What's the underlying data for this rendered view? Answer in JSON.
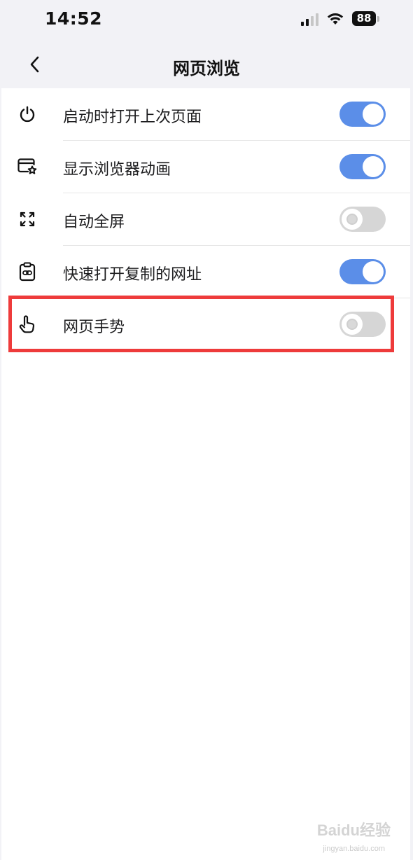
{
  "status_bar": {
    "time": "14:52",
    "battery": "88",
    "icons": [
      "cellular-signal-icon",
      "wifi-icon",
      "battery-icon"
    ]
  },
  "nav": {
    "title": "网页浏览",
    "back_icon": "chevron-left-icon"
  },
  "settings": [
    {
      "label": "启动时打开上次页面",
      "icon": "power-icon",
      "enabled": true
    },
    {
      "label": "显示浏览器动画",
      "icon": "browser-star-icon",
      "enabled": true
    },
    {
      "label": "自动全屏",
      "icon": "fullscreen-icon",
      "enabled": false
    },
    {
      "label": "快速打开复制的网址",
      "icon": "clipboard-link-icon",
      "enabled": true
    },
    {
      "label": "网页手势",
      "icon": "hand-gesture-icon",
      "enabled": false
    }
  ],
  "highlight": {
    "color": "#ee3b3b",
    "target": "网页手势"
  },
  "colors": {
    "toggle_on": "#5b8ee8",
    "toggle_off": "#d6d6d6",
    "background": "#f2f2f6"
  },
  "watermark": {
    "text": "Baidu经验",
    "subtext": "jingyan.baidu.com"
  }
}
